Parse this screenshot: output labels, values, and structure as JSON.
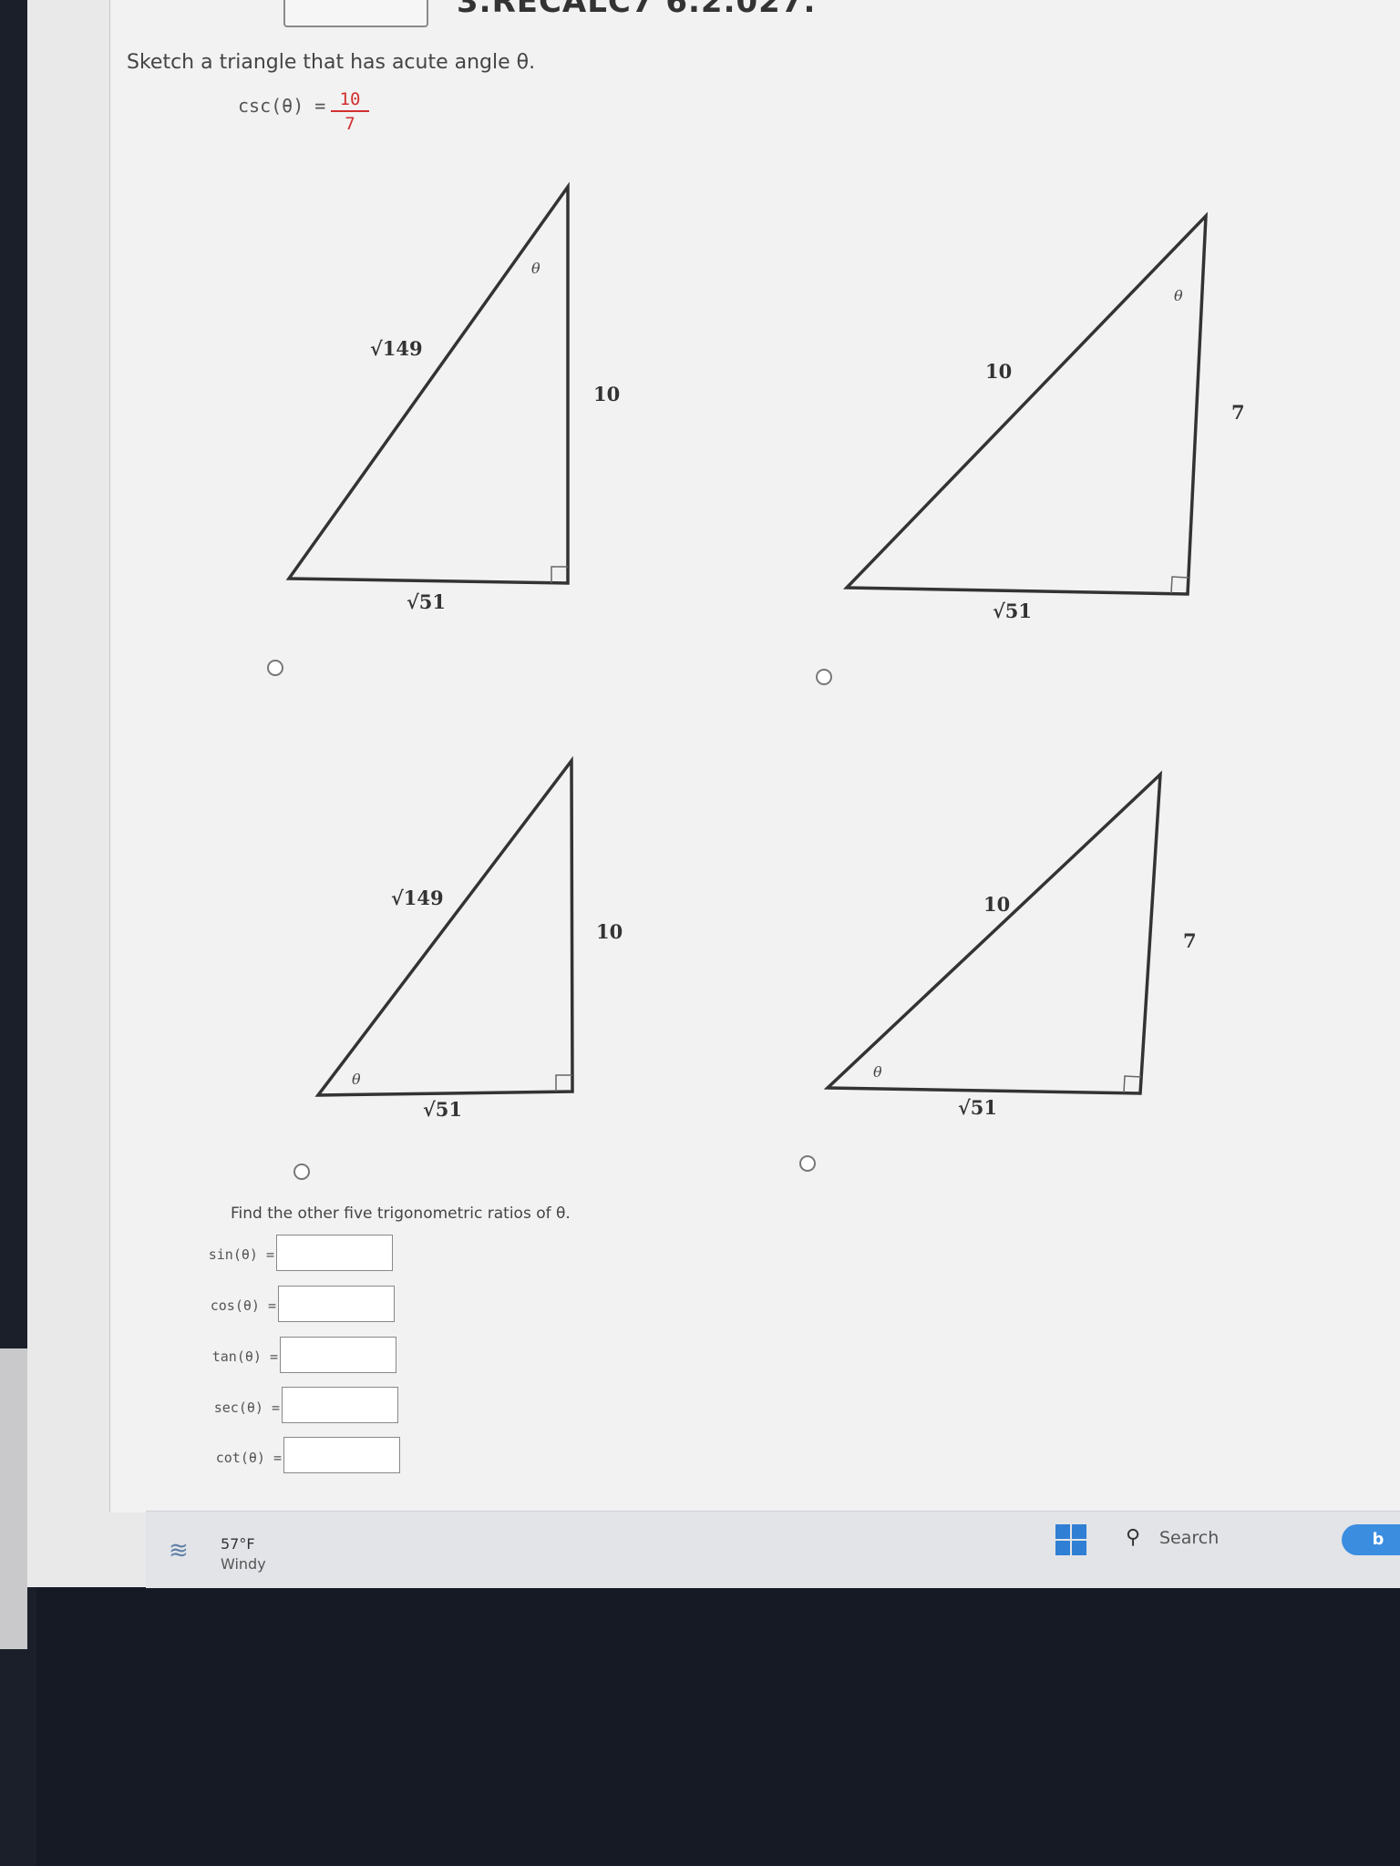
{
  "header": {
    "problem_id": "3.RECALC7 6.2.027."
  },
  "question": {
    "prompt": "Sketch a triangle that has acute angle θ.",
    "given_lhs": "csc(θ) =",
    "given_num": "10",
    "given_den": "7"
  },
  "choices": [
    {
      "hyp": "√149",
      "vert": "10",
      "base": "√51",
      "theta": "θ"
    },
    {
      "hyp": "10",
      "vert": "7",
      "base": "√51",
      "theta": "θ"
    },
    {
      "hyp": "√149",
      "vert": "10",
      "base": "√51",
      "theta": "θ"
    },
    {
      "hyp": "10",
      "vert": "7",
      "base": "√51",
      "theta": "θ"
    }
  ],
  "ratios": {
    "prompt": "Find the other five trigonometric ratios of θ.",
    "items": [
      {
        "label": "sin(θ) =",
        "value": ""
      },
      {
        "label": "cos(θ) =",
        "value": ""
      },
      {
        "label": "tan(θ) =",
        "value": ""
      },
      {
        "label": "sec(θ) =",
        "value": ""
      },
      {
        "label": "cot(θ) =",
        "value": ""
      }
    ]
  },
  "taskbar": {
    "temperature": "57°F",
    "condition": "Windy",
    "search_placeholder": "Search",
    "weather_icon": "wind-icon",
    "accent": "#2f7fd4"
  }
}
